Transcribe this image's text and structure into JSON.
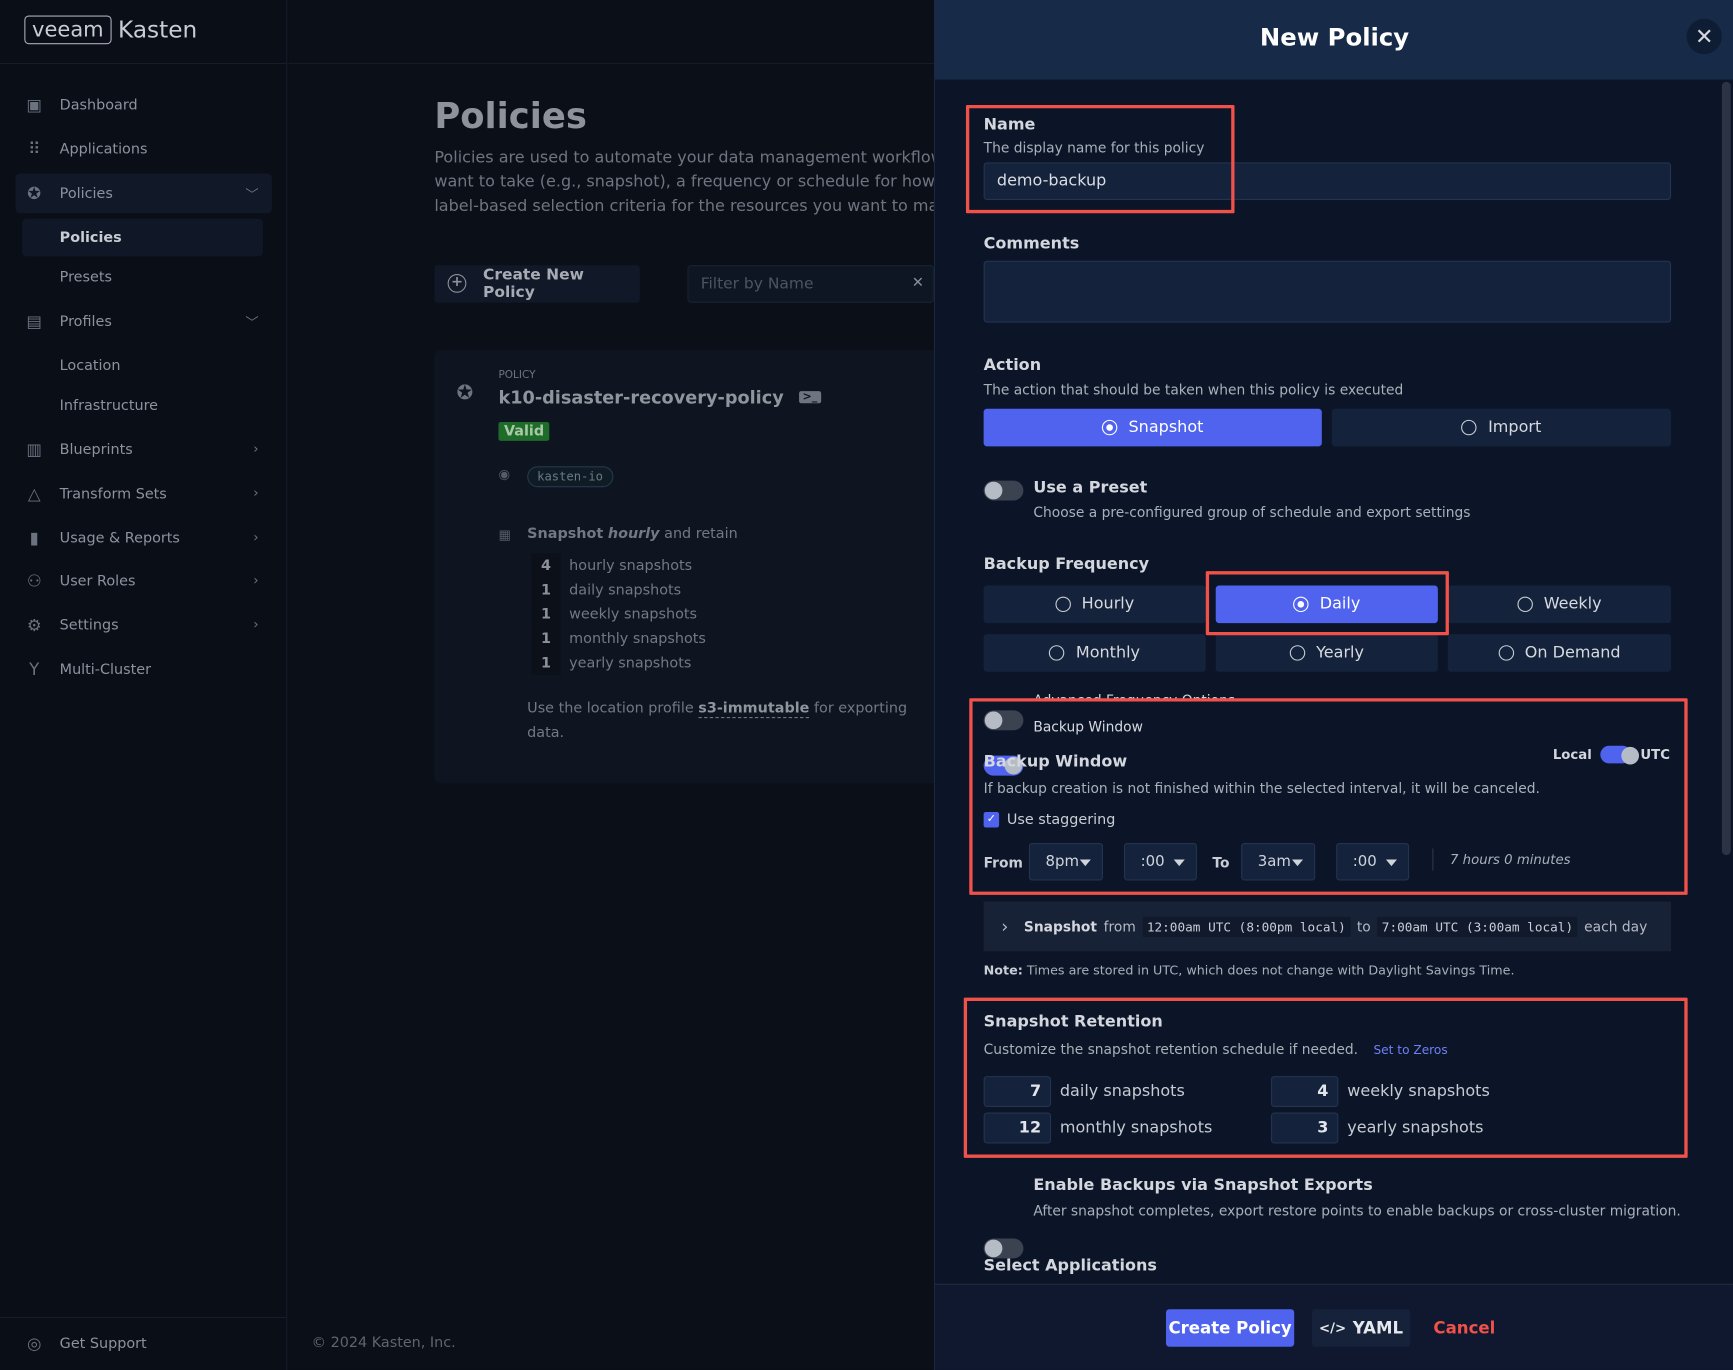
{
  "brand": {
    "logo_box": "veeam",
    "logo_text": "Kasten"
  },
  "sidebar": {
    "items": [
      {
        "label": "Dashboard",
        "icon": "dashboard-icon"
      },
      {
        "label": "Applications",
        "icon": "grid-icon"
      },
      {
        "label": "Policies",
        "icon": "ribbon-icon",
        "expanded": true
      },
      {
        "label": "Profiles",
        "icon": "document-icon",
        "expanded": true
      },
      {
        "label": "Blueprints",
        "icon": "map-icon"
      },
      {
        "label": "Transform Sets",
        "icon": "shapes-icon"
      },
      {
        "label": "Usage & Reports",
        "icon": "bar-chart-icon"
      },
      {
        "label": "User Roles",
        "icon": "users-icon"
      },
      {
        "label": "Settings",
        "icon": "gear-icon"
      },
      {
        "label": "Multi-Cluster",
        "icon": "branch-icon"
      }
    ],
    "policies_sub": [
      "Policies",
      "Presets"
    ],
    "profiles_sub": [
      "Location",
      "Infrastructure"
    ],
    "support": "Get Support"
  },
  "main": {
    "title": "Policies",
    "description": "Policies are used to automate your data management workflows. T want to take (e.g., snapshot), a frequency or schedule for how often label-based selection criteria for the resources you want to manage",
    "desc_lines": [
      "Policies are used to automate your data management workflows. T",
      "want to take (e.g., snapshot), a frequency or schedule for how often",
      "label-based selection criteria for the resources you want to manage"
    ],
    "create_button": "Create New Policy",
    "filter_placeholder": "Filter by Name",
    "card": {
      "eyebrow": "POLICY",
      "name": "k10-disaster-recovery-policy",
      "status": "Valid",
      "namespace": "kasten-io",
      "schedule_prefix": "Snapshot",
      "schedule_freq": "hourly",
      "schedule_suffix": "and retain",
      "retention": [
        {
          "n": "4",
          "label": "hourly snapshots"
        },
        {
          "n": "1",
          "label": "daily snapshots"
        },
        {
          "n": "1",
          "label": "weekly snapshots"
        },
        {
          "n": "1",
          "label": "monthly snapshots"
        },
        {
          "n": "1",
          "label": "yearly snapshots"
        }
      ],
      "export_prefix": "Use the location profile",
      "export_profile": "s3-immutable",
      "export_suffix": "for exporting",
      "export_end": "data."
    },
    "copyright": "© 2024 Kasten, Inc."
  },
  "panel": {
    "title": "New Policy",
    "name": {
      "label": "Name",
      "desc": "The display name for this policy",
      "value": "demo-backup"
    },
    "comments": {
      "label": "Comments",
      "value": ""
    },
    "action": {
      "label": "Action",
      "desc": "The action that should be taken when this policy is executed",
      "options": [
        "Snapshot",
        "Import"
      ],
      "selected": "Snapshot"
    },
    "preset": {
      "label": "Use a Preset",
      "desc": "Choose a pre-configured group of schedule and export settings",
      "on": false
    },
    "frequency": {
      "label": "Backup Frequency",
      "options": [
        "Hourly",
        "Daily",
        "Weekly",
        "Monthly",
        "Yearly",
        "On Demand"
      ],
      "selected": "Daily"
    },
    "advanced": {
      "label": "Advanced Frequency Options",
      "on": false
    },
    "backup_window_toggle": {
      "label": "Backup Window",
      "on": true
    },
    "backup_window": {
      "title": "Backup Window",
      "desc": "If backup creation is not finished within the selected interval, it will be canceled.",
      "local": "Local",
      "utc": "UTC",
      "tz_utc": true,
      "staggering": "Use staggering",
      "staggering_checked": true,
      "from_label": "From",
      "from_hour": "8pm",
      "from_min": ":00",
      "to_label": "To",
      "to_hour": "3am",
      "to_min": ":00",
      "duration": "7 hours 0 minutes"
    },
    "summary": {
      "prefix": "Snapshot",
      "from": "from",
      "start": "12:00am UTC (8:00pm local)",
      "to": "to",
      "end": "7:00am UTC (3:00am local)",
      "suffix": "each day"
    },
    "note": {
      "bold": "Note:",
      "text": "Times are stored in UTC, which does not change with Daylight Savings Time."
    },
    "retention": {
      "title": "Snapshot Retention",
      "desc": "Customize the snapshot retention schedule if needed.",
      "reset_link": "Set to Zeros",
      "fields": [
        {
          "value": "7",
          "label": "daily snapshots"
        },
        {
          "value": "4",
          "label": "weekly snapshots"
        },
        {
          "value": "12",
          "label": "monthly snapshots"
        },
        {
          "value": "3",
          "label": "yearly snapshots"
        }
      ]
    },
    "exports": {
      "label": "Enable Backups via Snapshot Exports",
      "desc": "After snapshot completes, export restore points to enable backups or cross-cluster migration.",
      "on": false
    },
    "select_apps": "Select Applications",
    "footer": {
      "create": "Create Policy",
      "yaml": "YAML",
      "cancel": "Cancel"
    }
  },
  "colors": {
    "accent": "#4f63ef",
    "highlight": "#f0524a",
    "cancel": "#f0524a",
    "valid": "#1f6b2a",
    "link": "#6f7ff5"
  }
}
